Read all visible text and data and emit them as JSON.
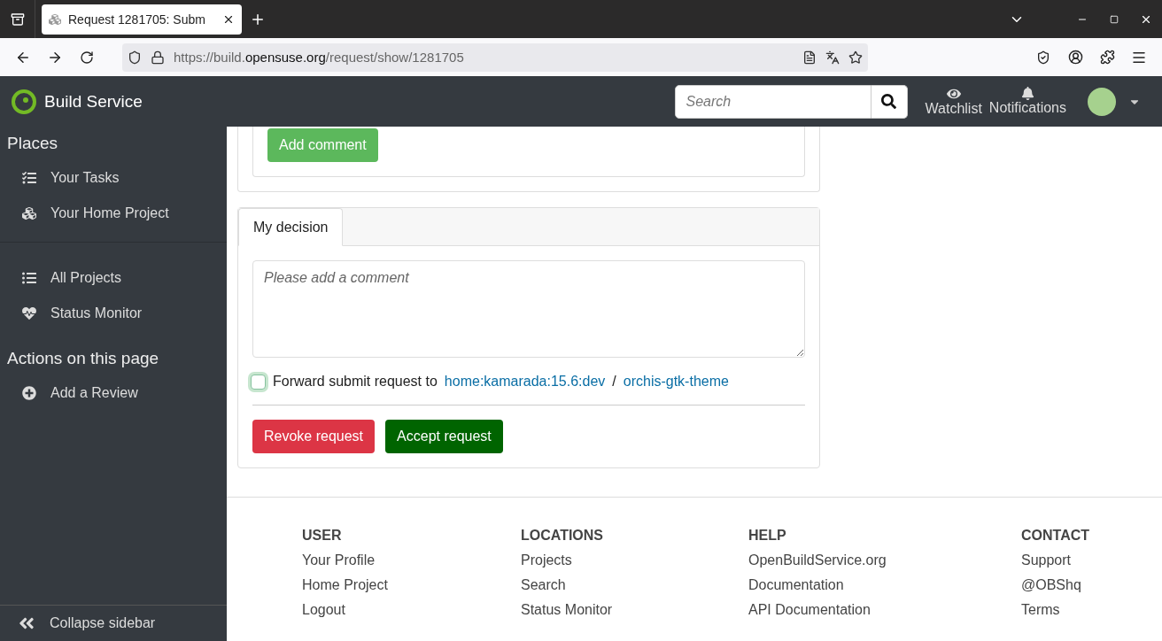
{
  "browser": {
    "tab_title": "Request 1281705: Subm",
    "url_prefix": "https://build.",
    "url_domain": "opensuse.org",
    "url_path": "/request/show/1281705"
  },
  "header": {
    "brand": "Build Service",
    "search": {
      "placeholder": "Search"
    },
    "nav": [
      "Watchlist",
      "Notifications"
    ]
  },
  "sidebar": {
    "sections": [
      {
        "title": "Places",
        "groups": [
          [
            {
              "label": "Your Tasks",
              "kind": "tasks"
            },
            {
              "label": "Your Home Project",
              "kind": "cubes"
            }
          ],
          [
            {
              "label": "All Projects",
              "kind": "list"
            },
            {
              "label": "Status Monitor",
              "kind": "heartbeat"
            }
          ]
        ]
      },
      {
        "title": "Actions on this page",
        "groups": [
          [
            {
              "label": "Add a Review",
              "kind": "plus"
            }
          ]
        ]
      }
    ],
    "collapse": "Collapse sidebar"
  },
  "comment_card": {
    "button": "Add comment"
  },
  "decision": {
    "tabs": [
      {
        "label": "My decision",
        "selected": true
      }
    ],
    "comment": {
      "placeholder": "Please add a comment"
    },
    "forward": {
      "checked": false,
      "text": "Forward submit request to",
      "project": "home:kamarada:15.6:dev",
      "separator": "/",
      "package": "orchis-gtk-theme"
    },
    "buttons": [
      {
        "label": "Revoke request",
        "kind": "danger"
      },
      {
        "label": "Accept request",
        "kind": "success"
      }
    ]
  },
  "footer": {
    "columns": [
      {
        "heading": "USER",
        "links": [
          "Your Profile",
          "Home Project",
          "Logout"
        ]
      },
      {
        "heading": "LOCATIONS",
        "links": [
          "Projects",
          "Search",
          "Status Monitor"
        ]
      },
      {
        "heading": "HELP",
        "links": [
          "OpenBuildService.org",
          "Documentation",
          "API Documentation"
        ]
      },
      {
        "heading": "CONTACT",
        "links": [
          "Support",
          "@OBShq",
          "Terms"
        ]
      }
    ]
  }
}
